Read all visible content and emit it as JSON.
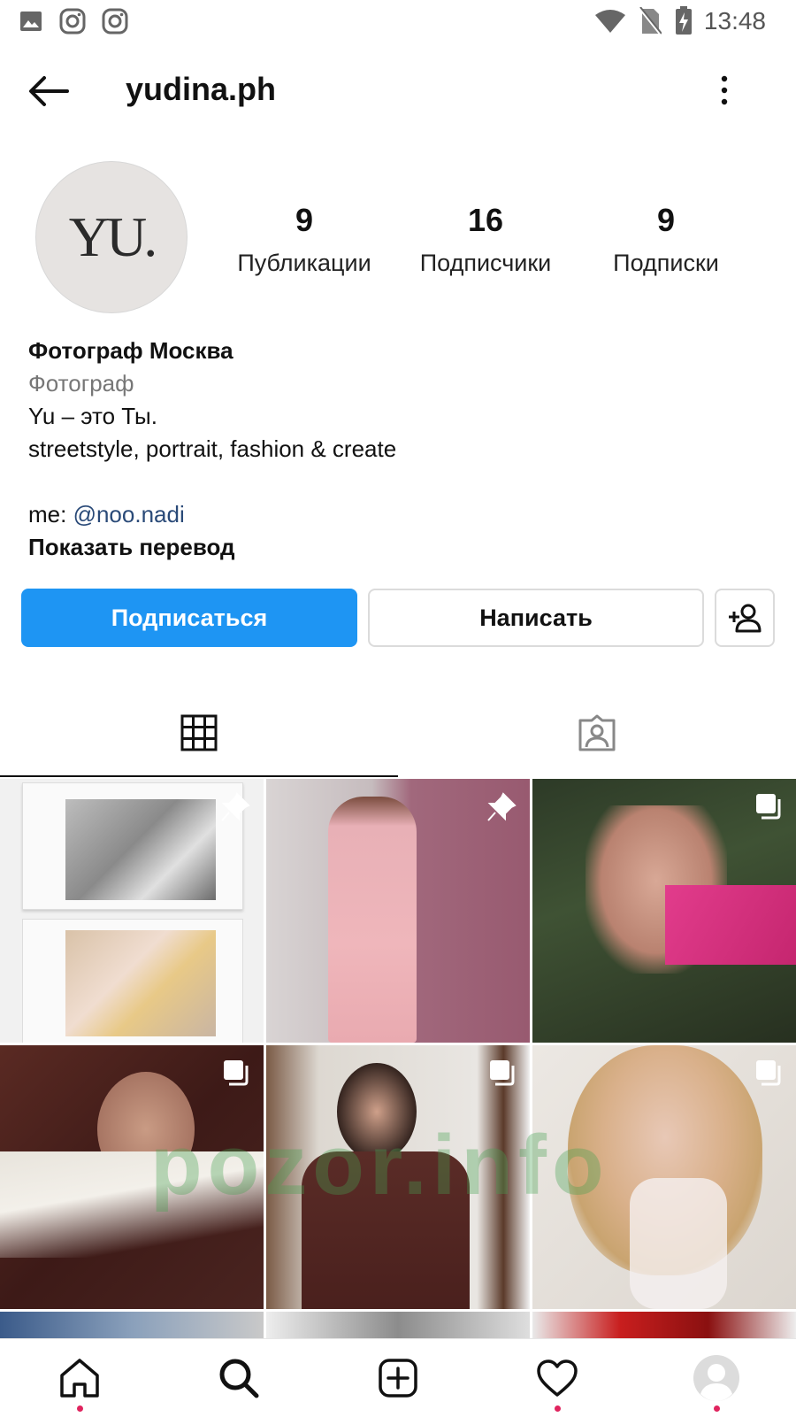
{
  "status_bar": {
    "time": "13:48"
  },
  "header": {
    "username": "yudina.ph"
  },
  "profile": {
    "avatar_text": "YU.",
    "stats": [
      {
        "value": "9",
        "label": "Публикации"
      },
      {
        "value": "16",
        "label": "Подписчики"
      },
      {
        "value": "9",
        "label": "Подписки"
      }
    ],
    "bio": {
      "name": "Фотограф Москва",
      "category": "Фотограф",
      "line1": "Yu – это Ты.",
      "line2": "streetstyle, portrait, fashion & create",
      "me_prefix": "me:",
      "mention": "@noo.nadi",
      "translate": "Показать перевод"
    }
  },
  "actions": {
    "follow": "Подписаться",
    "message": "Написать"
  },
  "watermark": "pozor.info",
  "colors": {
    "accent": "#1e95f3",
    "link": "#2a4a78",
    "notification": "#e0245e"
  }
}
